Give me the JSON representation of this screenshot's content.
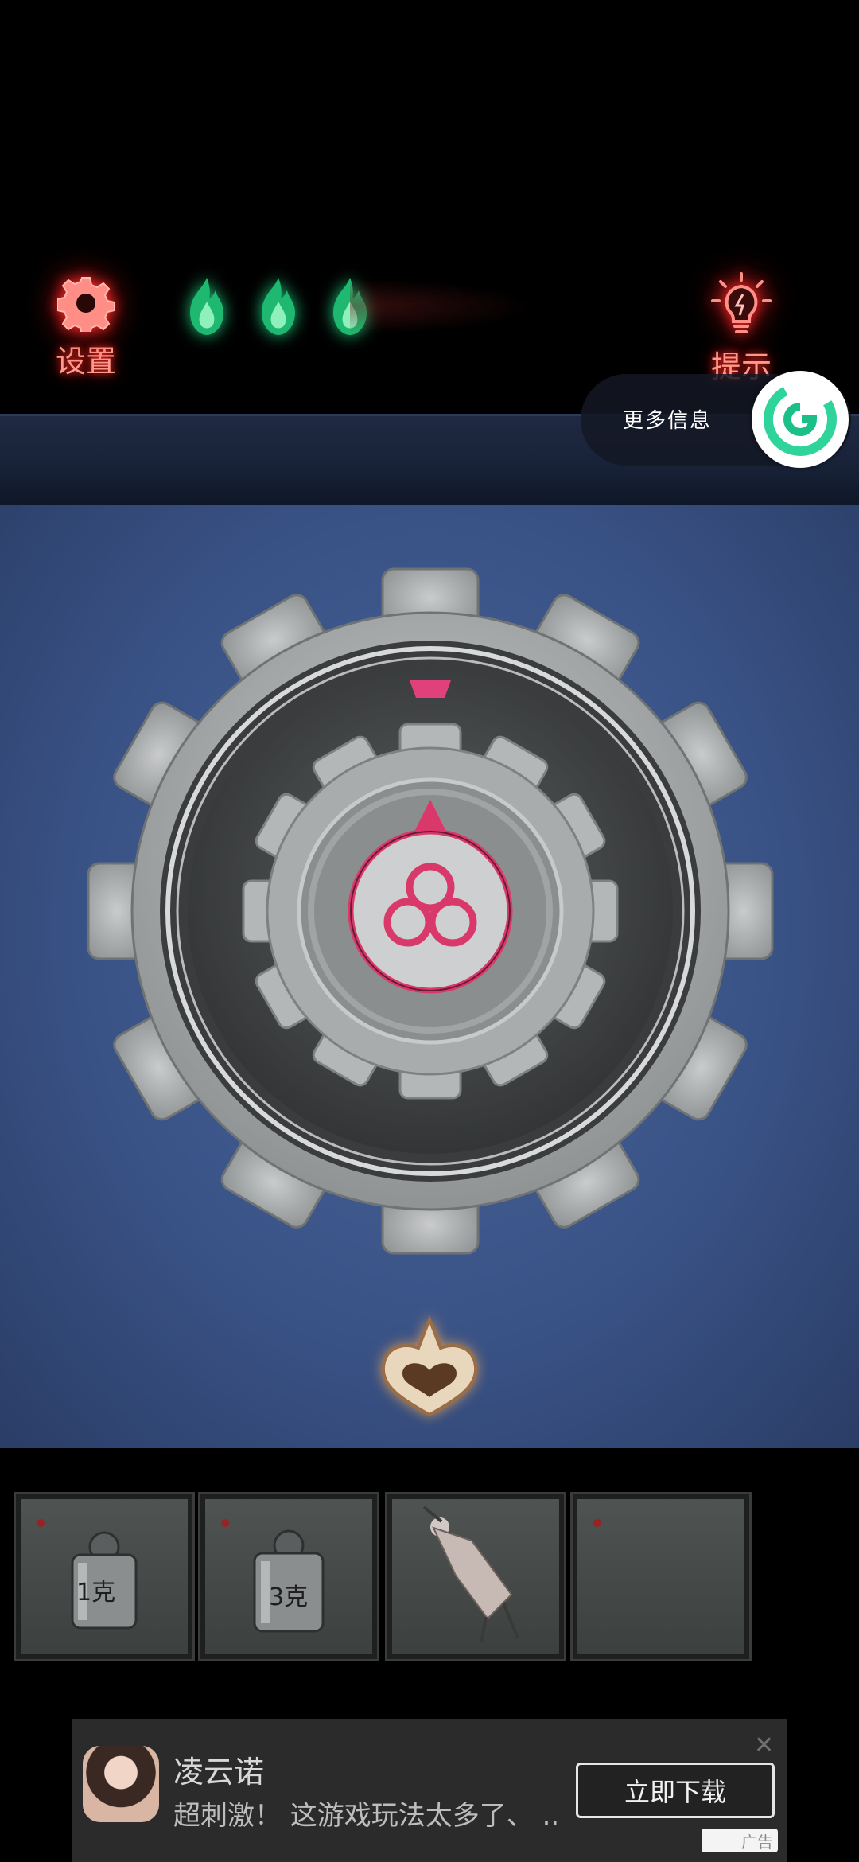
{
  "hud": {
    "settings_label": "设置",
    "hint_label": "提示",
    "lives": [
      {
        "icon": "green-flame-icon"
      },
      {
        "icon": "green-flame-icon"
      },
      {
        "icon": "green-flame-icon"
      }
    ]
  },
  "overlay": {
    "more_info_label": "更多信息",
    "logo_icon": "g-logo-icon"
  },
  "puzzle": {
    "dial_symbol": "club-trefoil-icon",
    "pointer": "triangle-pointer-icon",
    "marker": "pink-marker-icon",
    "bottom_emblem": "fleur-emblem-icon"
  },
  "inventory": {
    "slots": [
      {
        "item": "weight-1g-icon",
        "label": "1克"
      },
      {
        "item": "weight-3g-icon",
        "label": "3克"
      },
      {
        "item": "doll-figure-icon",
        "label": ""
      },
      {
        "item": "empty-slot",
        "label": ""
      }
    ]
  },
  "ad": {
    "title": "凌云诺",
    "description": "超刺激！ 这游戏玩法太多了、 ..",
    "cta_label": "立即下载",
    "close_label": "✕",
    "tag_label": "广告"
  },
  "colors": {
    "hud_glow": "#ff2a2a",
    "flame": "#21c97f",
    "dial_pink": "#d9386a",
    "panel_blue": "#3a5387"
  }
}
